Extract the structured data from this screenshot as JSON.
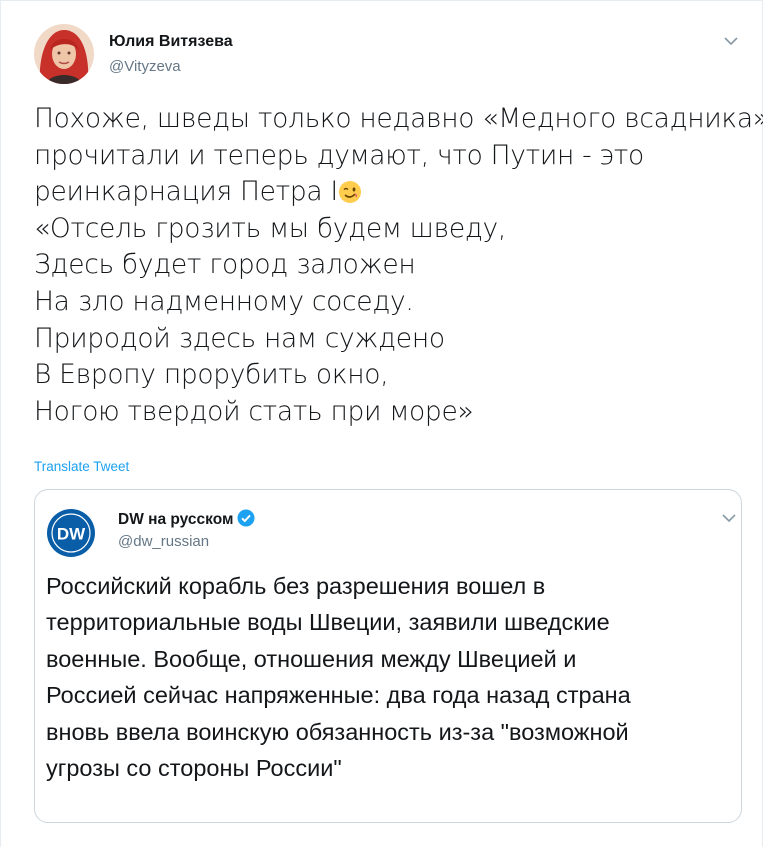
{
  "tweet": {
    "author": {
      "name": "Юлия Витязева",
      "handle": "@Vityzeva"
    },
    "text_lines": [
      "Похоже, шведы только недавно «Медного всадника»",
      "прочитали и теперь думают, что Путин - это",
      "реинкарнация Петра I",
      "«Отсель грозить мы будем шведу,",
      "Здесь будет город заложен",
      "На зло надменному соседу.",
      "Природой здесь нам суждено",
      "В Европу прорубить окно,",
      "Ногою твердой стать при море»"
    ],
    "emoji": "winking-face-emoji",
    "translate_label": "Translate Tweet"
  },
  "quoted_tweet": {
    "author": {
      "name": "DW на русском",
      "handle": "@dw_russian",
      "verified": true,
      "avatar_text": "DW"
    },
    "text_lines": [
      "Российский корабль без разрешения вошел в",
      "территориальные воды Швеции, заявили шведские",
      "военные. Вообще, отношения между Швецией и",
      "Россией сейчас напряженные: два года назад страна",
      "вновь ввела воинскую обязанность из-за \"возможной",
      "угрозы со стороны России\""
    ]
  },
  "colors": {
    "link": "#1da1f2",
    "secondary_text": "#657786",
    "border": "#ccd6dd",
    "dw_blue": "#0a5ea8"
  }
}
